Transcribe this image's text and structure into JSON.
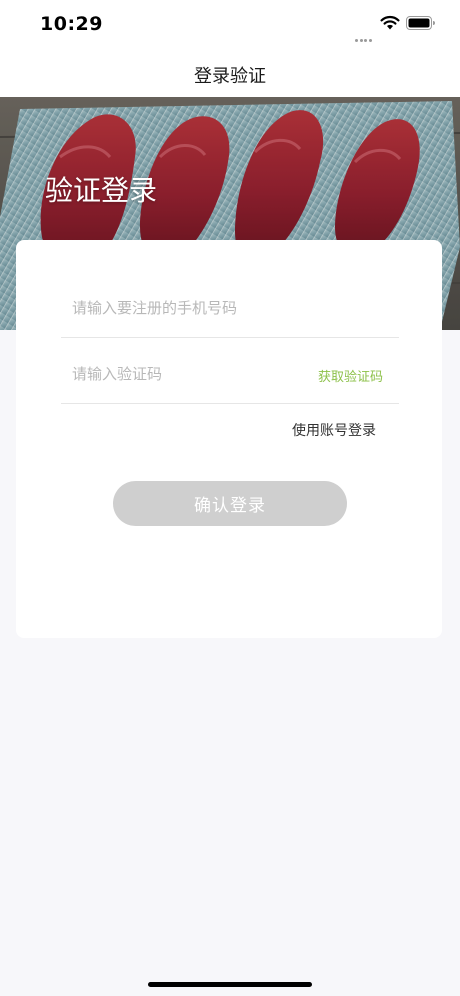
{
  "status_bar": {
    "time": "10:29",
    "icons": [
      "signal-dots-icon",
      "wifi-icon",
      "battery-icon"
    ]
  },
  "nav": {
    "title": "登录验证"
  },
  "hero": {
    "title": "验证登录",
    "image": "raw-beef-steaks-on-glass-tray"
  },
  "form": {
    "phone_placeholder": "请输入要注册的手机号码",
    "phone_value": "",
    "code_placeholder": "请输入验证码",
    "code_value": "",
    "get_code_label": "获取验证码",
    "account_login_label": "使用账号登录",
    "confirm_label": "确认登录"
  },
  "colors": {
    "accent_green": "#8dc14a",
    "button_disabled": "#cfcfcf",
    "page_background": "#f7f7fa"
  }
}
